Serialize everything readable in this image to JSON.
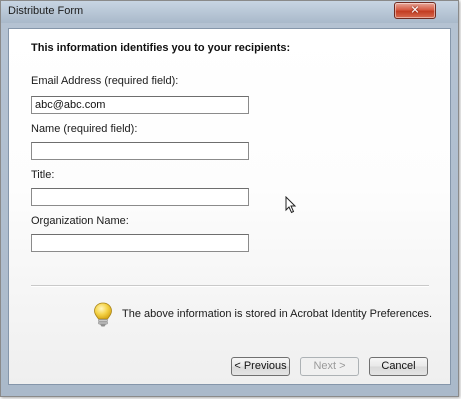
{
  "window": {
    "title": "Distribute Form",
    "close_glyph": "✕"
  },
  "form": {
    "heading": "This information identifies you to your recipients:",
    "fields": [
      {
        "label": "Email Address (required field):",
        "value": "abc@abc.com"
      },
      {
        "label": "Name (required field):",
        "value": ""
      },
      {
        "label": "Title:",
        "value": ""
      },
      {
        "label": "Organization Name:",
        "value": ""
      }
    ]
  },
  "info": {
    "icon": "lightbulb-icon",
    "text": "The above information is stored in Acrobat Identity Preferences."
  },
  "buttons": {
    "previous": "< Previous",
    "next": "Next >",
    "cancel": "Cancel"
  },
  "colors": {
    "accent_close": "#c8452b",
    "bulb": "#f5d44a"
  }
}
